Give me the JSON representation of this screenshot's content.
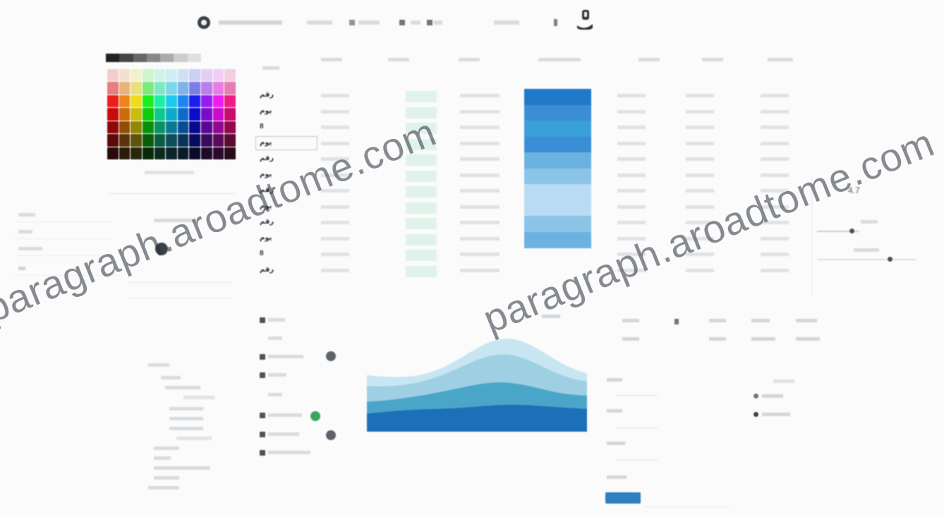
{
  "watermark": {
    "left": "paragraph.aroadtome.com",
    "right": "paragraph.aroadtome.com"
  },
  "colors": {
    "accent": "#2d7fc0",
    "toggle_on": "#3aa55d",
    "heat_1": "#1f78c8",
    "heat_2": "#3a8ed6",
    "heat_3": "#3aa0d8",
    "heat_4": "#6ab3e0",
    "heat_5": "#8cc4e8",
    "heat_6": "#b9dcf2",
    "chart_dark": "#1d6fb8",
    "chart_mid": "#4aa6c8",
    "chart_light": "#9fcfe3",
    "chart_top": "#c7e6f1"
  },
  "toolbar": {
    "icons": [
      "logo-icon",
      "grid-icon",
      "list-icon",
      "search-icon",
      "user-icon"
    ]
  },
  "table": {
    "row_labels": [
      "رقم",
      "يوم",
      "8",
      "يوم",
      "رقم",
      "يوم",
      "رقم",
      "يوم",
      "رقم",
      "يوم",
      "8",
      "رقم"
    ]
  },
  "zoom": {
    "level": "4.7"
  },
  "icons": {
    "logo": "logo-icon",
    "avatar": "user-icon",
    "gear": "gear-icon",
    "check": "checkbox-icon",
    "toggle": "toggle-icon"
  }
}
